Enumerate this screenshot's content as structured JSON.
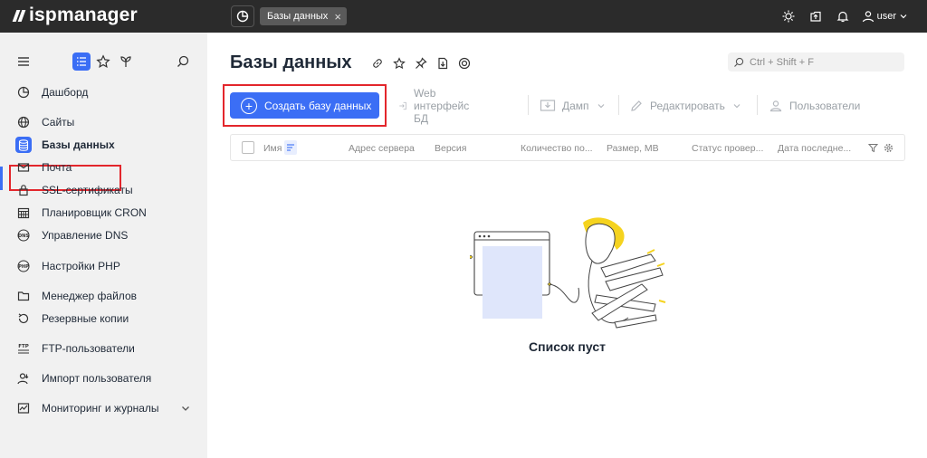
{
  "topbar": {
    "logo_text": "ispmanager",
    "tab_label": "Базы данных",
    "tab_close": "×",
    "user_label": "user"
  },
  "sidebar": {
    "items": [
      {
        "label": "Дашборд",
        "icon": "dashboard-icon"
      },
      {
        "label": "Сайты",
        "icon": "globe-icon"
      },
      {
        "label": "Базы данных",
        "icon": "database-icon",
        "active": true
      },
      {
        "label": "Почта",
        "icon": "mail-icon"
      },
      {
        "label": "SSL-сертификаты",
        "icon": "lock-icon"
      },
      {
        "label": "Планировщик CRON",
        "icon": "calendar-icon"
      },
      {
        "label": "Управление DNS",
        "icon": "dns-icon"
      },
      {
        "label": "Настройки PHP",
        "icon": "php-icon"
      },
      {
        "label": "Менеджер файлов",
        "icon": "folder-icon"
      },
      {
        "label": "Резервные копии",
        "icon": "backup-icon"
      },
      {
        "label": "FTP-пользователи",
        "icon": "ftp-icon"
      },
      {
        "label": "Импорт пользователя",
        "icon": "import-user-icon"
      },
      {
        "label": "Мониторинг и журналы",
        "icon": "monitoring-icon"
      }
    ]
  },
  "main": {
    "title": "Базы данных",
    "search_placeholder": "Ctrl + Shift + F",
    "toolbar": {
      "create": "Создать базу данных",
      "web": "Web интерфейс БД",
      "dump": "Дамп",
      "edit": "Редактировать",
      "users": "Пользователи"
    },
    "columns": [
      "Имя",
      "Адрес сервера",
      "Версия",
      "Количество по...",
      "Размер, MB",
      "Статус провер...",
      "Дата последне..."
    ],
    "empty_text": "Список пуст"
  },
  "colors": {
    "accent": "#3b6ef5",
    "topbar_bg": "#2b2b2b",
    "sidebar_bg": "#f1f1f1",
    "highlight": "#e3262c",
    "illustration_yellow": "#f5d31f"
  }
}
